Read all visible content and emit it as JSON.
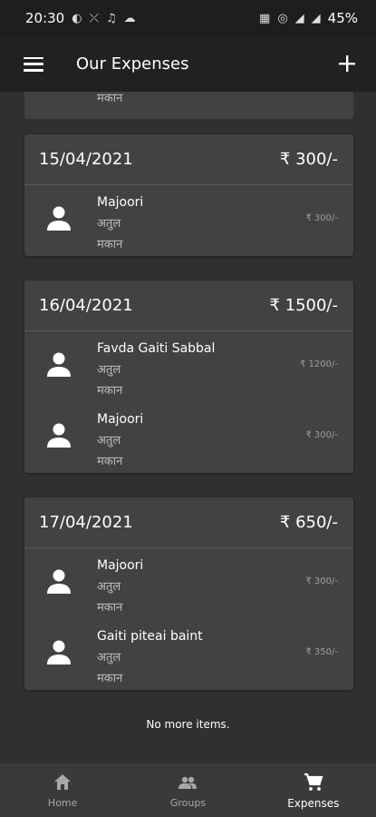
{
  "status_bar": {
    "time": "20:30",
    "left_icons": [
      "app-icon",
      "missed-call-icon",
      "notification-bell-icon",
      "cloud-icon"
    ],
    "right_icons": [
      "volte-icon",
      "hotspot-icon",
      "signal-icon",
      "signal-icon"
    ],
    "battery": "45%"
  },
  "app_bar": {
    "title": "Our Expenses",
    "menu_icon": "hamburger-menu-icon",
    "add_icon": "plus-icon"
  },
  "partial_card": {
    "line": "मकान"
  },
  "cards": [
    {
      "date": "15/04/2021",
      "total": "₹ 300/-",
      "entries": [
        {
          "name": "Majoori",
          "person": "अतुल",
          "category": "मकान",
          "amount": "₹ 300/-"
        }
      ]
    },
    {
      "date": "16/04/2021",
      "total": "₹ 1500/-",
      "entries": [
        {
          "name": "Favda  Gaiti  Sabbal",
          "person": "अतुल",
          "category": "मकान",
          "amount": "₹ 1200/-"
        },
        {
          "name": "Majoori",
          "person": "अतुल",
          "category": "मकान",
          "amount": "₹ 300/-"
        }
      ]
    },
    {
      "date": "17/04/2021",
      "total": "₹ 650/-",
      "entries": [
        {
          "name": "Majoori",
          "person": "अतुल",
          "category": "मकान",
          "amount": "₹ 300/-"
        },
        {
          "name": "Gaiti piteai  baint",
          "person": "अतुल",
          "category": "मकान",
          "amount": "₹ 350/-"
        }
      ]
    }
  ],
  "list_footer": "No more items.",
  "bottom_nav": [
    {
      "label": "Home",
      "icon": "home-icon",
      "active": false
    },
    {
      "label": "Groups",
      "icon": "groups-icon",
      "active": false
    },
    {
      "label": "Expenses",
      "icon": "cart-icon",
      "active": true
    }
  ]
}
